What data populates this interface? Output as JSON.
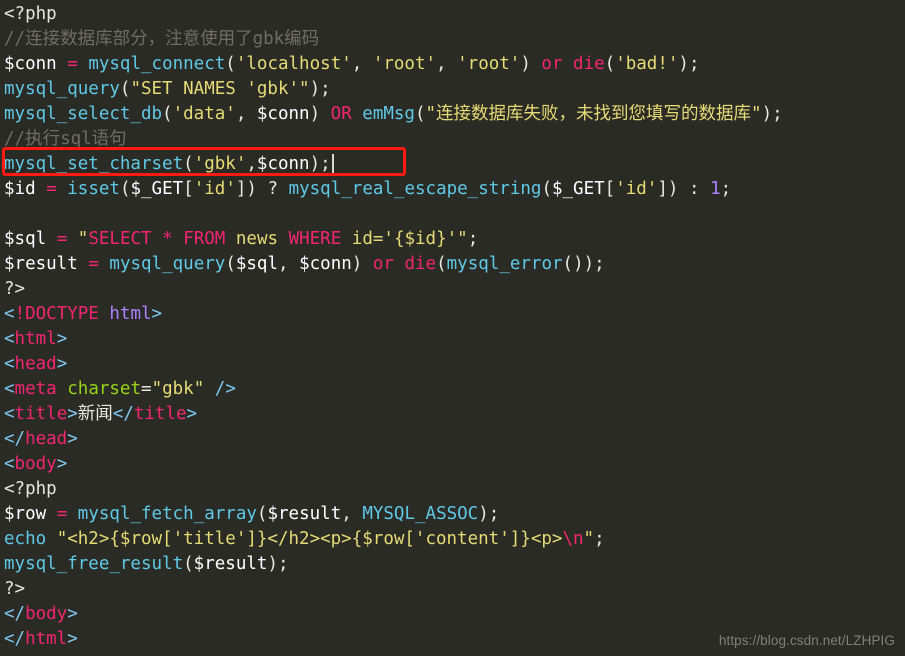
{
  "editor": {
    "background_color": "#2b2b26",
    "font_size_px": 17.5,
    "line_height_px": 25,
    "cursor_visible": true,
    "highlight": {
      "color": "#fb1b13",
      "line_index": 6,
      "target_text": "mysql_set_charset('gbk',$conn);"
    },
    "colors": {
      "plain": "#e8e8e3",
      "comment": "#6e6e66",
      "operator": "#f1266f",
      "function": "#5fc9e8",
      "string": "#e6db74",
      "keyword": "#f1266f",
      "number": "#ae81ff",
      "tag_bracket": "#7ec7f0",
      "tag_name": "#f1266f",
      "attribute": "#97d418"
    },
    "lines": [
      {
        "id": "line-1",
        "text": "<?php"
      },
      {
        "id": "line-2",
        "text": "//连接数据库部分，注意使用了gbk编码"
      },
      {
        "id": "line-3",
        "text": "$conn = mysql_connect('localhost', 'root', 'root') or die('bad!');"
      },
      {
        "id": "line-4",
        "text": "mysql_query(\"SET NAMES 'gbk'\");"
      },
      {
        "id": "line-5",
        "text": "mysql_select_db('data', $conn) OR emMsg(\"连接数据库失败，未找到您填写的数据库\");"
      },
      {
        "id": "line-6",
        "text": "//执行sql语句"
      },
      {
        "id": "line-7",
        "text": "mysql_set_charset('gbk',$conn);"
      },
      {
        "id": "line-8",
        "text": "$id = isset($_GET['id']) ? mysql_real_escape_string($_GET['id']) : 1;"
      },
      {
        "id": "line-9",
        "text": ""
      },
      {
        "id": "line-10",
        "text": "$sql = \"SELECT * FROM news WHERE id='{$id}'\";"
      },
      {
        "id": "line-11",
        "text": "$result = mysql_query($sql, $conn) or die(mysql_error());"
      },
      {
        "id": "line-12",
        "text": "?>"
      },
      {
        "id": "line-13",
        "text": "<!DOCTYPE html>"
      },
      {
        "id": "line-14",
        "text": "<html>"
      },
      {
        "id": "line-15",
        "text": "<head>"
      },
      {
        "id": "line-16",
        "text": "<meta charset=\"gbk\" />"
      },
      {
        "id": "line-17",
        "text": "<title>新闻</title>"
      },
      {
        "id": "line-18",
        "text": "</head>"
      },
      {
        "id": "line-19",
        "text": "<body>"
      },
      {
        "id": "line-20",
        "text": "<?php"
      },
      {
        "id": "line-21",
        "text": "$row = mysql_fetch_array($result, MYSQL_ASSOC);"
      },
      {
        "id": "line-22",
        "text": "echo \"<h2>{$row['title']}</h2><p>{$row['content']}<p>\\n\";"
      },
      {
        "id": "line-23",
        "text": "mysql_free_result($result);"
      },
      {
        "id": "line-24",
        "text": "?>"
      },
      {
        "id": "line-25",
        "text": "</body>"
      },
      {
        "id": "line-26",
        "text": "</html>"
      }
    ]
  },
  "watermark": {
    "text": "https://blog.csdn.net/LZHPIG"
  }
}
